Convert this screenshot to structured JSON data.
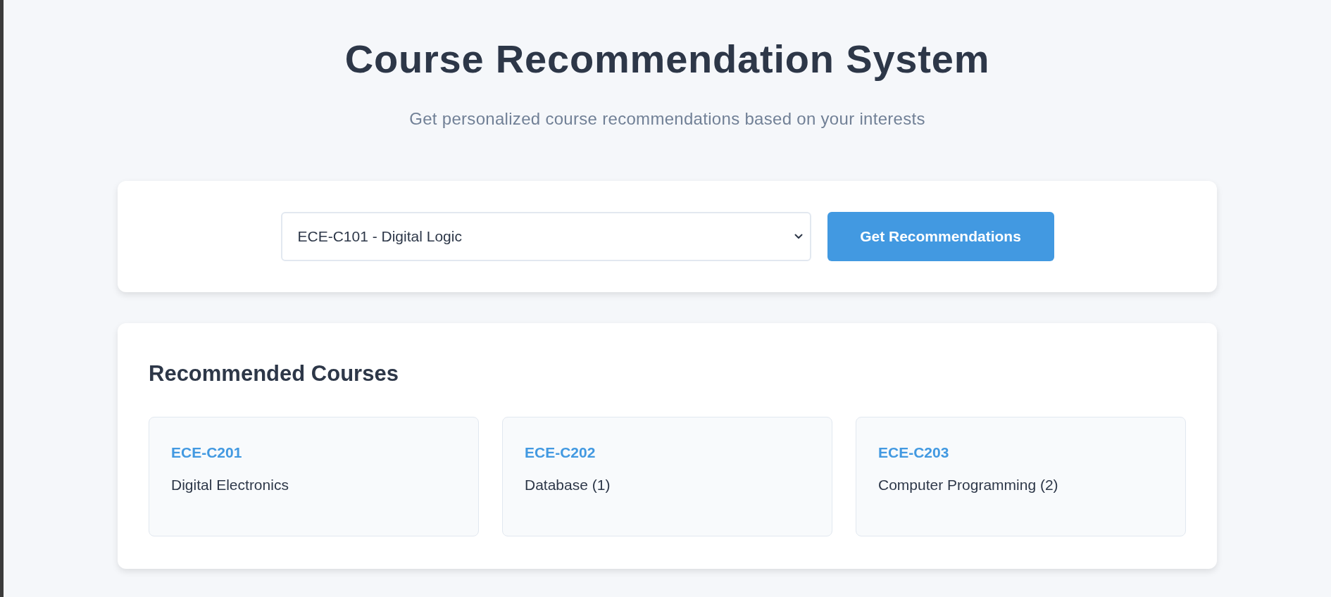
{
  "header": {
    "title": "Course Recommendation System",
    "subtitle": "Get personalized course recommendations based on your interests"
  },
  "search": {
    "course_select": {
      "value": "ECE-C101 - Digital Logic"
    },
    "button": "Get Recommendations"
  },
  "results": {
    "heading": "Recommended Courses",
    "courses": [
      {
        "code": "ECE-C201",
        "name": "Digital Electronics"
      },
      {
        "code": "ECE-C202",
        "name": "Database (1)"
      },
      {
        "code": "ECE-C203",
        "name": "Computer Programming (2)"
      }
    ]
  }
}
